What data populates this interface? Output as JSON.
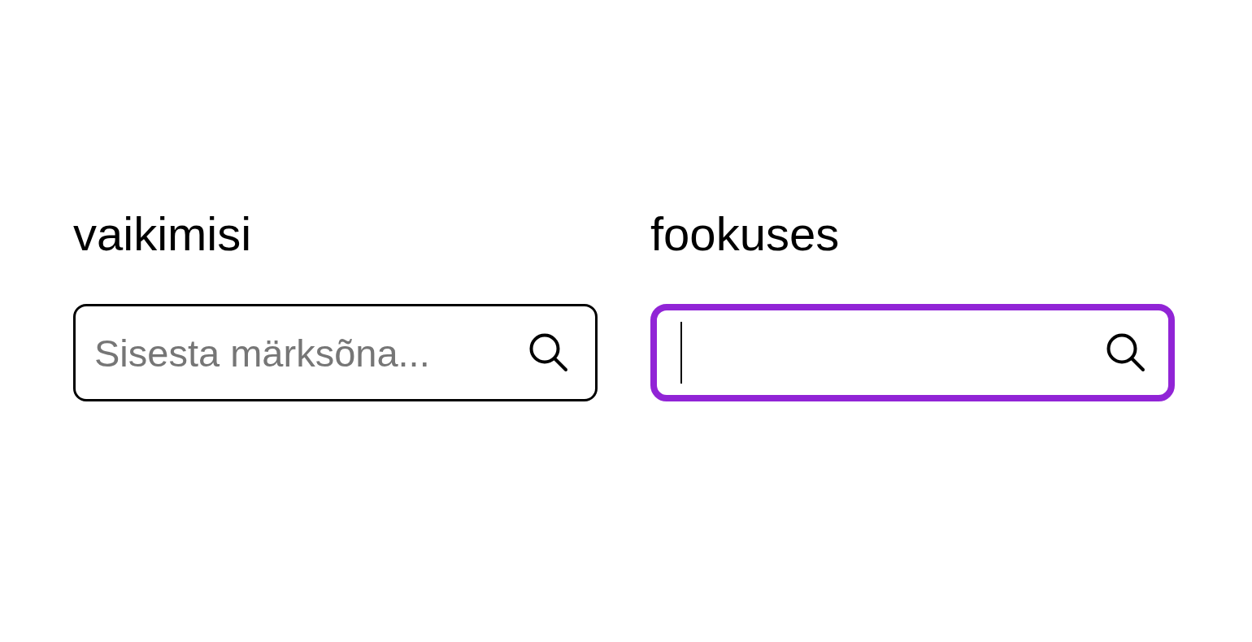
{
  "fields": [
    {
      "label": "vaikimisi",
      "placeholder": "Sisesta märksõna...",
      "focused": false
    },
    {
      "label": "fookuses",
      "focused": true
    }
  ]
}
